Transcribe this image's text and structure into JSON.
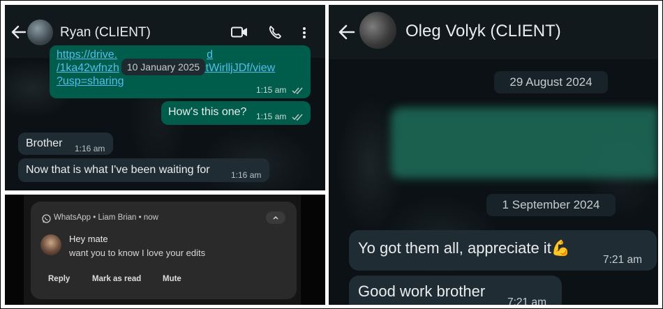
{
  "left_chat": {
    "contact_name": "Ryan (CLIENT)",
    "date_pill": "10 January 2025",
    "link_line1": "https://drive.",
    "link_line1_tail": "d",
    "link_line2": "/1ka42wfnzh",
    "link_line2_tail": "21tWirlljJDf/view",
    "link_line3": "?usp=sharing",
    "link_time": "1:15 am",
    "msg_out": "How's this one?",
    "msg_out_time": "1:15 am",
    "msg_in1": "Brother",
    "msg_in1_time": "1:16 am",
    "msg_in2": "Now that is what I've been waiting for",
    "msg_in2_time": "1:16 am"
  },
  "notification": {
    "header": "WhatsApp • Liam Brian • now",
    "title": "Hey mate",
    "body": "want you to know I love your edits",
    "actions": [
      "Reply",
      "Mark as read",
      "Mute"
    ]
  },
  "right_chat": {
    "contact_name": "Oleg Volyk (CLIENT)",
    "date_pill1": "29 August 2024",
    "date_pill2": "1 September 2024",
    "msg1": "Yo got them all, appreciate it",
    "msg1_emoji": "💪",
    "msg1_time": "7:21 am",
    "msg2": "Good work brother",
    "msg2_time": "7:21 am"
  },
  "icons": [
    "back-arrow-icon",
    "video-call-icon",
    "phone-icon",
    "more-options-icon",
    "whatsapp-icon",
    "chevron-up-icon",
    "double-check-icon",
    "flexed-biceps-emoji"
  ],
  "colors": {
    "incoming_bubble": "#202c33",
    "outgoing_bubble": "#005c4b",
    "link": "#53bdeb",
    "header": "#11191d"
  }
}
